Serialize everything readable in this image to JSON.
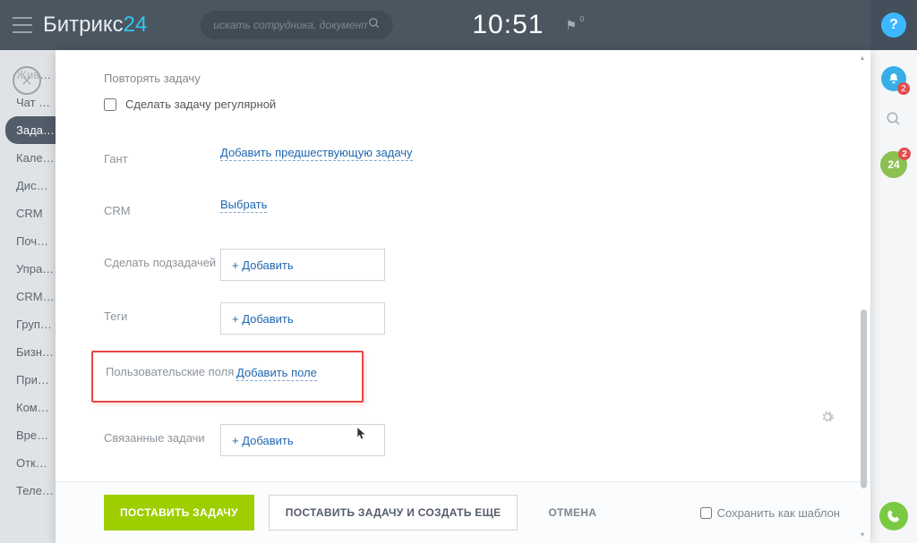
{
  "header": {
    "brand_main": "Битрикс",
    "brand_accent": "24",
    "search_placeholder": "искать сотрудника, документ, п",
    "clock": "10:51",
    "flag_count": "0",
    "help": "?"
  },
  "leftnav": {
    "items": [
      "Жив…",
      "Чат …",
      "Зада…",
      "Кале…",
      "Дис…",
      "CRM",
      "Поч…",
      "Упра…",
      "CRM…",
      "Груп…",
      "Бизн…",
      "При…",
      "Ком…",
      "Вре…",
      "Отк…",
      "Теле…"
    ],
    "active_index": 2
  },
  "rightrail": {
    "bell_badge": "2",
    "b24_label": "24",
    "b24_badge": "2"
  },
  "form": {
    "repeat_title": "Повторять задачу",
    "regular_label": "Сделать задачу регулярной",
    "gantt_label": "Гант",
    "gantt_link": "Добавить предшествующую задачу",
    "crm_label": "CRM",
    "crm_link": "Выбрать",
    "subtask_label": "Сделать подзадачей",
    "tags_label": "Теги",
    "userfields_label": "Пользовательские поля",
    "userfields_link": "Добавить поле",
    "related_label": "Связанные задачи",
    "add_plus": "+ Добавить"
  },
  "footer": {
    "submit": "Поставить задачу",
    "submit_more": "Поставить задачу и создать еще",
    "cancel": "Отмена",
    "save_template": "Сохранить как шаблон"
  }
}
